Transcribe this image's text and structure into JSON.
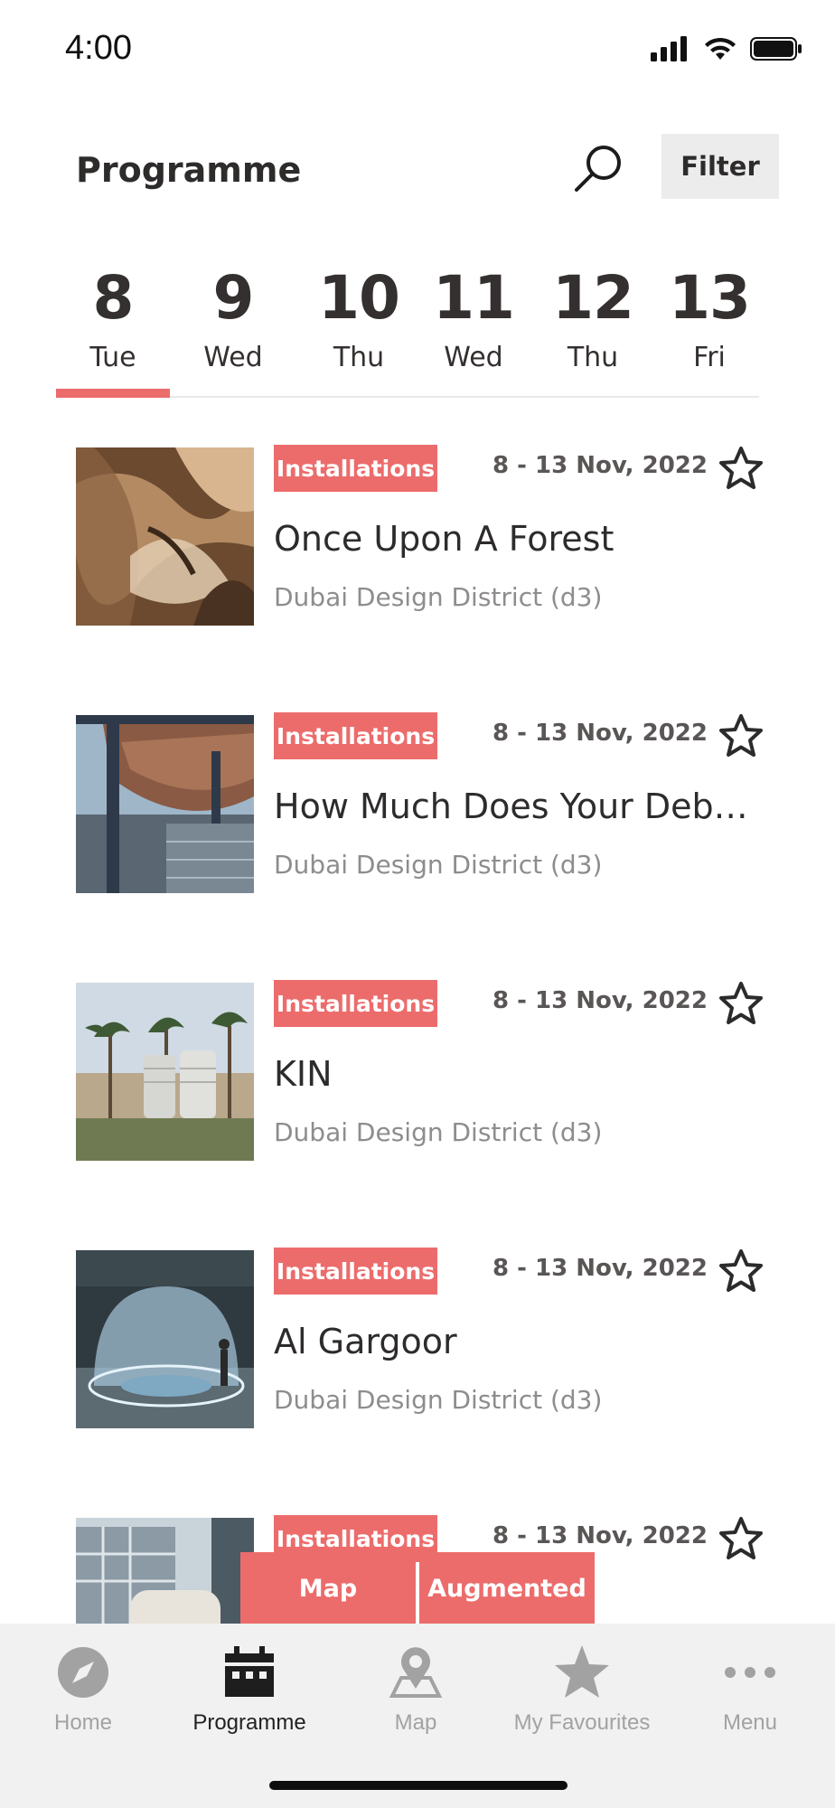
{
  "status_bar": {
    "time": "4:00"
  },
  "header": {
    "title": "Programme",
    "filter_label": "Filter"
  },
  "date_tabs": [
    {
      "num": "8",
      "day": "Tue",
      "active": true
    },
    {
      "num": "9",
      "day": "Wed"
    },
    {
      "num": "10",
      "day": "Thu"
    },
    {
      "num": "11",
      "day": "Wed"
    },
    {
      "num": "12",
      "day": "Thu"
    },
    {
      "num": "13",
      "day": "Fri"
    }
  ],
  "events": [
    {
      "tag": "Installations",
      "date": "8 - 13 Nov, 2022",
      "title": "Once Upon A Forest",
      "venue": "Dubai Design District (d3)"
    },
    {
      "tag": "Installations",
      "date": "8 - 13 Nov, 2022",
      "title": "How Much Does Your Debri...",
      "venue": "Dubai Design District (d3)"
    },
    {
      "tag": "Installations",
      "date": "8 - 13 Nov, 2022",
      "title": "KIN",
      "venue": "Dubai Design District (d3)"
    },
    {
      "tag": "Installations",
      "date": "8 - 13 Nov, 2022",
      "title": "Al Gargoor",
      "venue": "Dubai Design District (d3)"
    },
    {
      "tag": "Installations",
      "date": "8 - 13 Nov, 2022",
      "title": "",
      "venue": ""
    }
  ],
  "float_buttons": {
    "map": "Map",
    "augmented": "Augmented"
  },
  "tab_bar": {
    "home": "Home",
    "programme": "Programme",
    "map": "Map",
    "favourites": "My Favourites",
    "menu": "Menu"
  },
  "colors": {
    "accent": "#ec6c6c",
    "text": "#2e2b2b",
    "muted": "#8f8c8c",
    "tabbar": "#f1f1f1"
  },
  "icons": [
    "search-icon",
    "star-outline-icon",
    "compass-icon",
    "calendar-icon",
    "map-pin-icon",
    "star-filled-icon",
    "more-dots-icon"
  ]
}
